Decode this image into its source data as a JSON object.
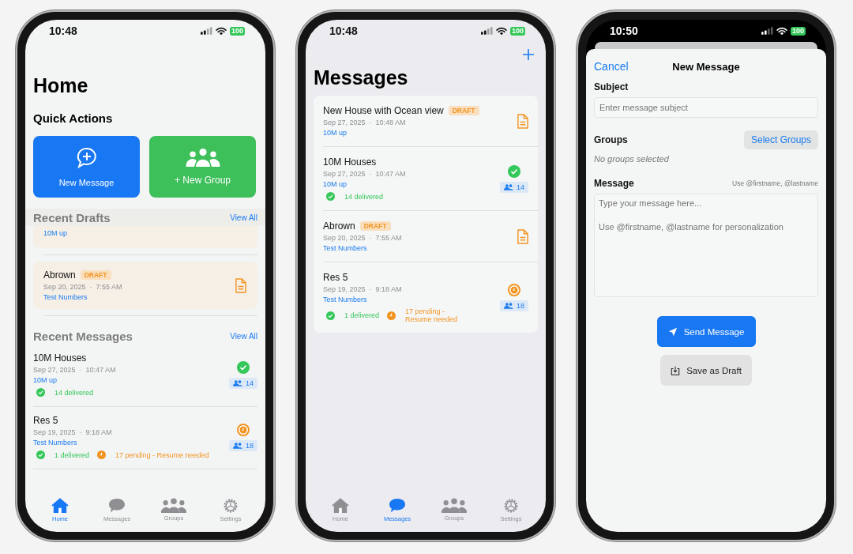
{
  "phones": [
    {
      "kind": "home",
      "status": {
        "time": "10:48",
        "battery": "100"
      },
      "title": "Home",
      "quick_actions": {
        "title": "Quick Actions",
        "items": [
          {
            "kind": "message",
            "label": "New Message",
            "color": "#1877f2"
          },
          {
            "kind": "group",
            "label": "+ New Group",
            "color": "#3dbf5a"
          }
        ]
      },
      "recent_drafts": {
        "title": "Recent Drafts",
        "link": "View All",
        "items": [
          {
            "partial": true,
            "group": "10M up"
          },
          {
            "partial": false,
            "title": "Abrown",
            "badge": "DRAFT",
            "meta": "Sep 20, 2025  ·  7:55 AM",
            "group": "Test Numbers"
          }
        ]
      },
      "recent_messages": {
        "title": "Recent Messages",
        "link": "View All",
        "items": [
          {
            "title": "10M Houses",
            "meta": "Sep 27, 2025  ·  10:47 AM",
            "group": "10M up",
            "recipients": "14",
            "stats": [
              {
                "kind": "delivered",
                "text": "14 delivered"
              }
            ]
          },
          {
            "title": "Res 5",
            "meta": "Sep 19, 2025  ·  9:18 AM",
            "group": "Test Numbers",
            "recipients": "18",
            "stats": [
              {
                "kind": "delivered",
                "text": "1 delivered"
              },
              {
                "kind": "pending",
                "text": "17 pending - Resume needed"
              }
            ]
          }
        ]
      },
      "tabs": [
        {
          "kind": "home",
          "label": "Home",
          "selected": true
        },
        {
          "kind": "messages",
          "label": "Messages",
          "selected": false
        },
        {
          "kind": "groups",
          "label": "Groups",
          "selected": false
        },
        {
          "kind": "settings",
          "label": "Settings",
          "selected": false
        }
      ]
    },
    {
      "kind": "messages",
      "status": {
        "time": "10:48",
        "battery": "100"
      },
      "title": "Messages",
      "items": [
        {
          "kind": "draft",
          "title": "New House with Ocean view",
          "badge": "DRAFT",
          "meta": "Sep 27, 2025  ·  10:48 AM",
          "group": "10M up"
        },
        {
          "kind": "message",
          "title": "10M Houses",
          "meta": "Sep 27, 2025  ·  10:47 AM",
          "group": "10M up",
          "recipients": "14",
          "stats": [
            {
              "kind": "delivered",
              "text": "14 delivered"
            }
          ]
        },
        {
          "kind": "draft",
          "title": "Abrown",
          "badge": "DRAFT",
          "meta": "Sep 20, 2025  ·  7:55 AM",
          "group": "Test Numbers"
        },
        {
          "kind": "message",
          "title": "Res 5",
          "meta": "Sep 19, 2025  ·  9:18 AM",
          "group": "Test Numbers",
          "recipients": "18",
          "stats": [
            {
              "kind": "delivered",
              "text": "1 delivered"
            },
            {
              "kind": "pending",
              "text": "17 pending - Resume needed"
            }
          ]
        }
      ],
      "tabs": [
        {
          "kind": "home",
          "label": "Home",
          "selected": false
        },
        {
          "kind": "messages",
          "label": "Messages",
          "selected": true
        },
        {
          "kind": "groups",
          "label": "Groups",
          "selected": false
        },
        {
          "kind": "settings",
          "label": "Settings",
          "selected": false
        }
      ]
    },
    {
      "kind": "compose",
      "status": {
        "time": "10:50",
        "battery": "100"
      },
      "cancel": "Cancel",
      "title": "New Message",
      "subject": {
        "label": "Subject",
        "placeholder": "Enter message subject"
      },
      "groups": {
        "label": "Groups",
        "button": "Select Groups",
        "empty": "No groups selected"
      },
      "message": {
        "label": "Message",
        "hint": "Use @firstname, @lastname",
        "placeholder": "Type your message here...\n\nUse @firstname, @lastname for personalization"
      },
      "send": "Send Message",
      "save_draft": "Save as Draft"
    }
  ]
}
